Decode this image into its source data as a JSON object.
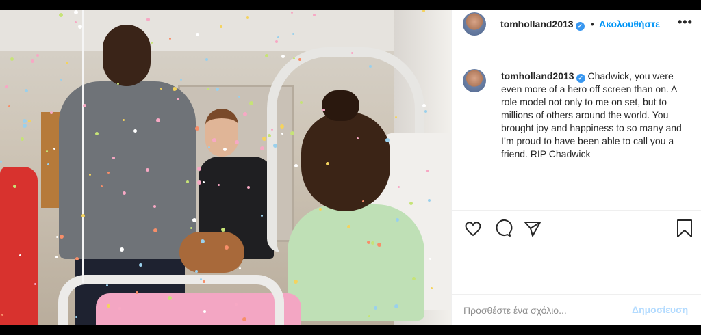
{
  "post": {
    "username": "tomholland2013",
    "verified_icon": "verified-check-icon",
    "follow_label": "Ακολουθήστε",
    "more_label": "•••",
    "caption": "Chadwick, you were even more of a hero off screen than on. A role model not only to me on set, but to millions of others around the world. You brought joy and happiness to so many and I’m proud to have been able to call you a friend. RIP Chadwick"
  },
  "actions": {
    "like_icon": "heart-icon",
    "comment_icon": "comment-icon",
    "share_icon": "paper-plane-icon",
    "save_icon": "bookmark-icon"
  },
  "comment": {
    "placeholder": "Προσθέστε ένα σχόλιο...",
    "post_label": "Δημοσίευση"
  },
  "colors": {
    "accent": "#0095f6",
    "post_disabled": "#b3dbff",
    "verified": "#3897f0"
  }
}
